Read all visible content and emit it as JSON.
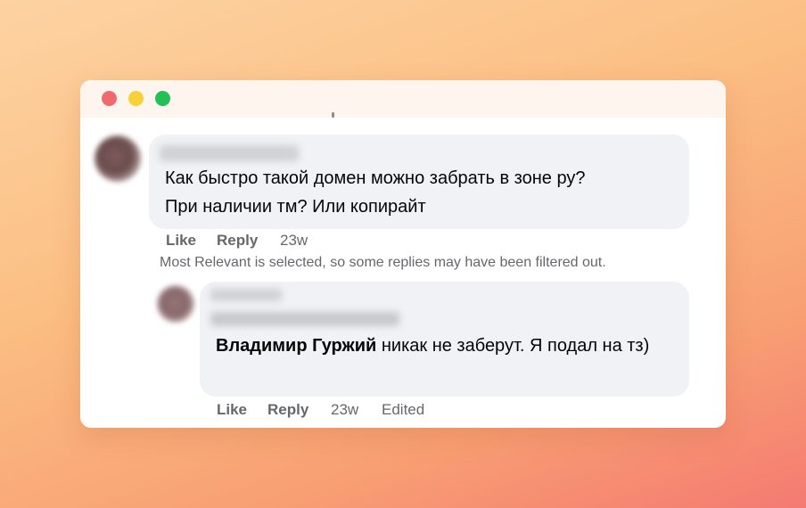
{
  "window": {
    "controls": [
      "close",
      "minimize",
      "maximize"
    ]
  },
  "comments": [
    {
      "text": "Как быстро такой домен можно забрать в зоне ру?\nПри наличии тм? Или копирайт",
      "actions": {
        "like": "Like",
        "reply": "Reply",
        "time": "23w"
      }
    }
  ],
  "notice": "Most Relevant is selected, so some replies may have been filtered out.",
  "reply": {
    "mention": "Владимир Гуржий",
    "text": " никак не заберут. Я подал на тз)",
    "actions": {
      "like": "Like",
      "reply": "Reply",
      "time": "23w",
      "edited": "Edited"
    }
  },
  "colors": {
    "bubble": "#f0f2f5",
    "secondary_text": "#65676b",
    "close_dot": "#ee6a6f",
    "minimize_dot": "#f6d137",
    "maximize_dot": "#22c057"
  }
}
